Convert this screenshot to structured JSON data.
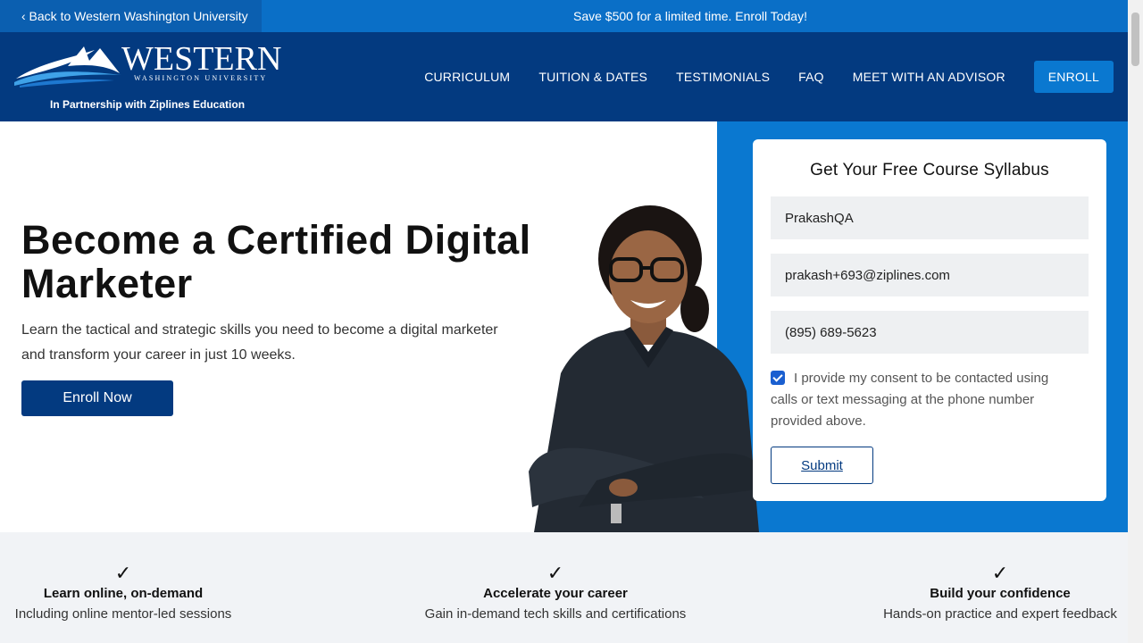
{
  "topbar": {
    "back_link": "‹ Back to Western Washington University",
    "promo": "Save $500 for a limited time. Enroll Today!"
  },
  "header": {
    "logo_word": "WESTERN",
    "logo_sub": "WASHINGTON UNIVERSITY",
    "partner": "In Partnership with Ziplines Education",
    "nav": [
      "CURRICULUM",
      "TUITION & DATES",
      "TESTIMONIALS",
      "FAQ",
      "MEET WITH AN ADVISOR"
    ],
    "enroll_label": "ENROLL"
  },
  "hero": {
    "title": "Become a Certified Digital Marketer",
    "subtitle": "Learn the tactical and strategic skills you need to become a digital marketer and transform your career in just 10 weeks.",
    "cta": "Enroll Now"
  },
  "form": {
    "title": "Get Your Free Course Syllabus",
    "name_value": "PrakashQA",
    "email_value": "prakash+693@ziplines.com",
    "phone_value": "(895) 689-5623",
    "consent_text": "I provide my consent to be contacted using calls or text messaging at the phone number provided above.",
    "consent_checked": true,
    "submit_label": "Submit"
  },
  "features": [
    {
      "title": "Learn online, on-demand",
      "desc": "Including online mentor-led sessions"
    },
    {
      "title": "Accelerate your career",
      "desc": "Gain in-demand tech skills and certifications"
    },
    {
      "title": "Build your confidence",
      "desc": "Hands-on practice and expert feedback"
    }
  ],
  "colors": {
    "brand_dark": "#033a80",
    "brand_blue": "#0a78d0",
    "topbar": "#0a6fc7"
  }
}
